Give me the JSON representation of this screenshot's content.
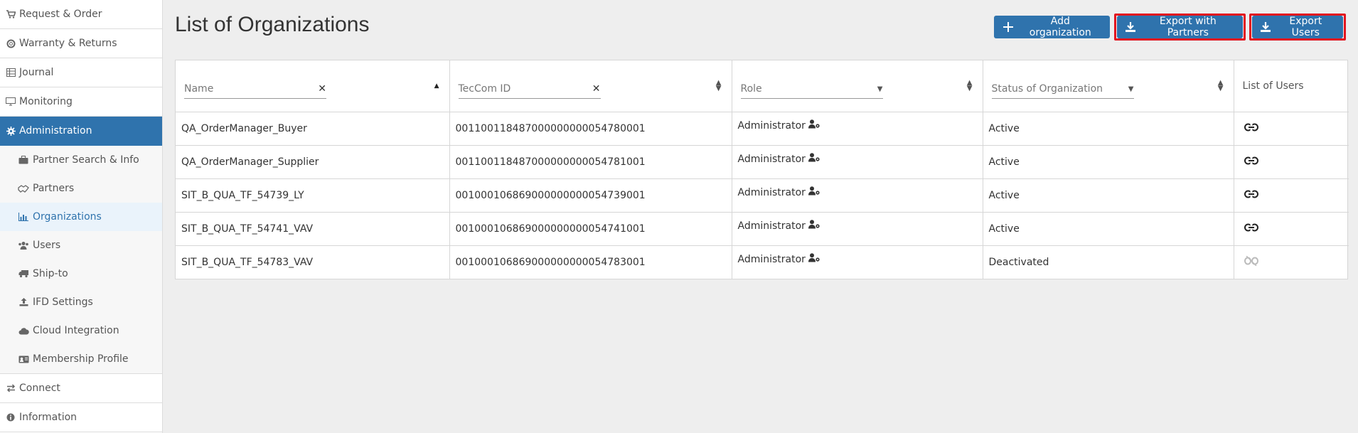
{
  "sidebar": {
    "items": [
      {
        "label": "Request & Order",
        "icon": "cart-icon"
      },
      {
        "label": "Warranty & Returns",
        "icon": "lifebuoy-icon"
      },
      {
        "label": "Journal",
        "icon": "table-icon"
      },
      {
        "label": "Monitoring",
        "icon": "monitor-icon"
      },
      {
        "label": "Administration",
        "icon": "gear-icon"
      },
      {
        "label": "Connect",
        "icon": "exchange-icon"
      },
      {
        "label": "Information",
        "icon": "info-icon"
      }
    ],
    "subitems": [
      {
        "label": "Partner Search & Info",
        "icon": "briefcase-icon"
      },
      {
        "label": "Partners",
        "icon": "handshake-icon"
      },
      {
        "label": "Organizations",
        "icon": "bar-chart-icon"
      },
      {
        "label": "Users",
        "icon": "users-icon"
      },
      {
        "label": "Ship-to",
        "icon": "truck-icon"
      },
      {
        "label": "IFD Settings",
        "icon": "upload-icon"
      },
      {
        "label": "Cloud Integration",
        "icon": "cloud-icon"
      },
      {
        "label": "Membership Profile",
        "icon": "id-card-icon"
      }
    ]
  },
  "main": {
    "title": "List of Organizations",
    "buttons": {
      "add": "Add organization",
      "export_partners": "Export with Partners",
      "export_users": "Export Users"
    },
    "columns": {
      "name": "Name",
      "teccom": "TecCom ID",
      "role": "Role",
      "status": "Status of Organization",
      "users": "List of Users"
    },
    "rows": [
      {
        "name": "QA_OrderManager_Buyer",
        "teccom": "001100118487000000000054780001",
        "role": "Administrator",
        "status": "Active",
        "linked": true
      },
      {
        "name": "QA_OrderManager_Supplier",
        "teccom": "001100118487000000000054781001",
        "role": "Administrator",
        "status": "Active",
        "linked": true
      },
      {
        "name": "SIT_B_QUA_TF_54739_LY",
        "teccom": "001000106869000000000054739001",
        "role": "Administrator",
        "status": "Active",
        "linked": true
      },
      {
        "name": "SIT_B_QUA_TF_54741_VAV",
        "teccom": "001000106869000000000054741001",
        "role": "Administrator",
        "status": "Active",
        "linked": true
      },
      {
        "name": "SIT_B_QUA_TF_54783_VAV",
        "teccom": "001000106869000000000054783001",
        "role": "Administrator",
        "status": "Deactivated",
        "linked": false
      }
    ]
  },
  "colors": {
    "primary": "#2f73ad",
    "highlight": "#e2141f"
  }
}
